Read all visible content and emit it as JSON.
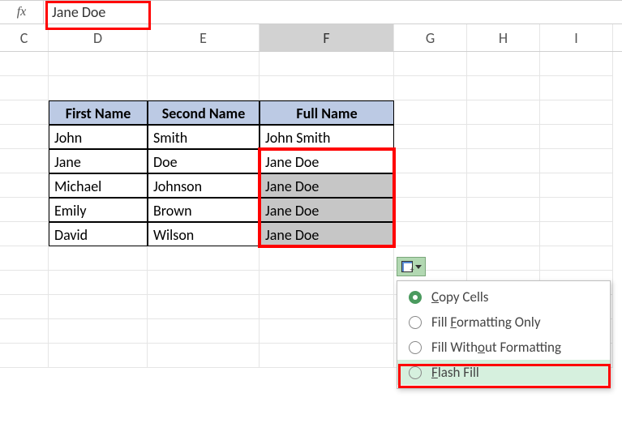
{
  "formula_bar": {
    "fx_label": "fx",
    "value": "Jane Doe"
  },
  "columns": [
    {
      "letter": "C"
    },
    {
      "letter": "D"
    },
    {
      "letter": "E"
    },
    {
      "letter": "F"
    },
    {
      "letter": "G"
    },
    {
      "letter": "H"
    },
    {
      "letter": "I"
    }
  ],
  "table": {
    "headers": [
      "First Name",
      "Second Name",
      "Full Name"
    ],
    "rows": [
      {
        "first": "John",
        "second": "Smith",
        "full": "John Smith",
        "shaded": false
      },
      {
        "first": "Jane",
        "second": "Doe",
        "full": "Jane Doe",
        "shaded": false
      },
      {
        "first": "Michael",
        "second": "Johnson",
        "full": "Jane Doe",
        "shaded": true
      },
      {
        "first": "Emily",
        "second": "Brown",
        "full": "Jane Doe",
        "shaded": true
      },
      {
        "first": "David",
        "second": "Wilson",
        "full": "Jane Doe",
        "shaded": true
      }
    ]
  },
  "autofill_menu": {
    "items": [
      {
        "label": "Copy Cells",
        "underline_idx": 0,
        "selected": true,
        "highlighted": false
      },
      {
        "label": "Fill Formatting Only",
        "underline_idx": 5,
        "selected": false,
        "highlighted": false
      },
      {
        "label": "Fill Without Formatting",
        "underline_idx": 5,
        "selected": false,
        "highlighted": false
      },
      {
        "label": "Flash Fill",
        "underline_idx": 0,
        "selected": false,
        "highlighted": true
      }
    ]
  }
}
